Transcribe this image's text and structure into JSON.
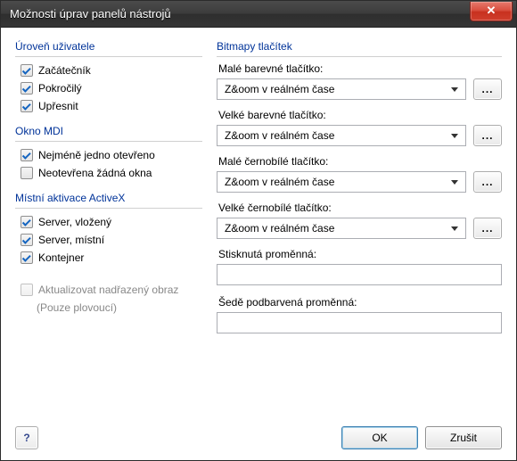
{
  "window": {
    "title": "Možnosti úprav panelů nástrojů"
  },
  "groups": {
    "userlevel": {
      "legend": "Úroveň uživatele",
      "beginner": "Začátečník",
      "advanced": "Pokročilý",
      "refine": "Upřesnit"
    },
    "mdi": {
      "legend": "Okno MDI",
      "atleast": "Nejméně jedno otevřeno",
      "none": "Neotevřena žádná okna"
    },
    "activex": {
      "legend": "Místní aktivace ActiveX",
      "server_embed": "Server, vložený",
      "server_local": "Server, místní",
      "container": "Kontejner"
    },
    "update": {
      "label": "Aktualizovat nadřazený obraz",
      "note": "(Pouze plovoucí)"
    },
    "bitmaps": {
      "legend": "Bitmapy tlačítek",
      "small_color_label": "Malé barevné tlačítko:",
      "large_color_label": "Velké barevné tlačítko:",
      "small_mono_label": "Malé černobílé tlačítko:",
      "large_mono_label": "Velké černobílé tlačítko:",
      "value": "Z&oom v reálném čase",
      "ellipsis": "..."
    },
    "vars": {
      "pressed_label": "Stisknutá proměnná:",
      "gray_label": "Šedě podbarvená proměnná:"
    }
  },
  "footer": {
    "help": "?",
    "ok": "OK",
    "cancel": "Zrušit"
  }
}
